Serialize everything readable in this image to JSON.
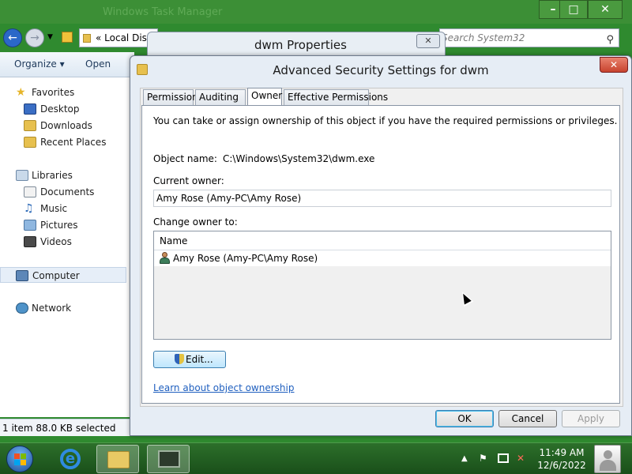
{
  "explorer": {
    "window_title": "Windows Task Manager",
    "address_crumb": "«  Local Disk",
    "search_placeholder": "Search System32",
    "toolbar": {
      "organize": "Organize ▾",
      "open": "Open"
    },
    "nav": {
      "favorites": "Favorites",
      "desktop": "Desktop",
      "downloads": "Downloads",
      "recent_places": "Recent Places",
      "libraries": "Libraries",
      "documents": "Documents",
      "music": "Music",
      "pictures": "Pictures",
      "videos": "Videos",
      "computer": "Computer",
      "network": "Network"
    },
    "status": "1 item 88.0 KB selected"
  },
  "properties_window": {
    "title": "dwm Properties",
    "close": "✕"
  },
  "dialog": {
    "title": "Advanced Security Settings for dwm",
    "close": "✕",
    "tabs": [
      "Permissions",
      "Auditing",
      "Owner",
      "Effective Permissions"
    ],
    "active_tab": "Owner",
    "intro_text": "You can take or assign ownership of this object if you have the required permissions or privileges.",
    "object_name_label": "Object name:",
    "object_name_value": "C:\\Windows\\System32\\dwm.exe",
    "current_owner_label": "Current owner:",
    "current_owner_value": "Amy Rose (Amy-PC\\Amy Rose)",
    "change_owner_label": "Change owner to:",
    "list_column": "Name",
    "owner_candidates": [
      "Amy Rose (Amy-PC\\Amy Rose)"
    ],
    "edit_button": "Edit...",
    "learn_link": "Learn about object ownership",
    "buttons": {
      "ok": "OK",
      "cancel": "Cancel",
      "apply": "Apply"
    },
    "apply_enabled": false
  },
  "taskbar": {
    "clock_time": "11:49 AM",
    "clock_date": "12/6/2022",
    "ie_glyph": "e",
    "tray": {
      "show_hidden": "▲",
      "flag": "⚑",
      "speaker": "✕"
    }
  },
  "icons": {
    "star": "favorites-star-icon",
    "library": "library-icon",
    "computer": "computer-icon",
    "network": "network-icon",
    "user": "user-icon",
    "shield": "uac-shield-icon"
  },
  "colors": {
    "desktop_green": "#2f8a2f",
    "dialog_close_red": "#c7432e",
    "link_blue": "#1f5fbf",
    "selected_button_border": "#3c7fb1"
  }
}
